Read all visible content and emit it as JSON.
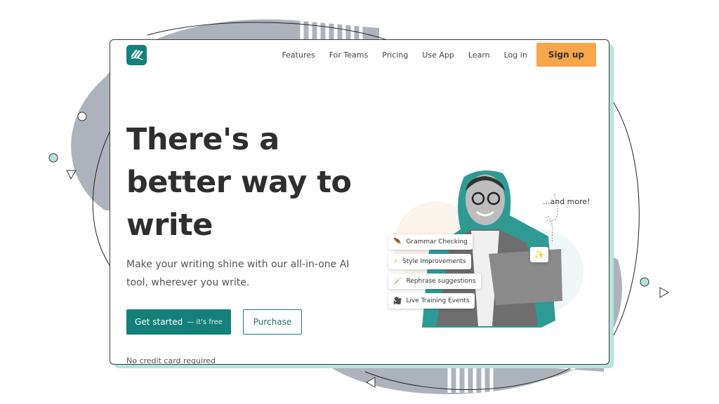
{
  "colors": {
    "brand": "#13807a",
    "accent": "#f7a64c",
    "shadow": "#b5e3dd",
    "blob": "#adb3bd"
  },
  "nav": {
    "logo": "logo-icon",
    "items": [
      "Features",
      "For Teams",
      "Pricing",
      "Use App",
      "Learn",
      "Log in"
    ],
    "signup": "Sign up"
  },
  "hero": {
    "title": "There's a better way to write",
    "subtitle": "Make your writing shine with our all-in-one AI tool, wherever you write.",
    "cta_primary": "Get started",
    "cta_primary_suffix": "— it's free",
    "cta_secondary": "Purchase",
    "note": "No credit card required"
  },
  "features": [
    {
      "label": "Grammar Checking",
      "icon": "feather-icon"
    },
    {
      "label": "Style Improvements",
      "icon": "lightning-icon"
    },
    {
      "label": "Rephrase suggestions",
      "icon": "magic-wand-icon"
    },
    {
      "label": "Live Training Events",
      "icon": "video-camera-icon"
    }
  ],
  "more": "...and more!"
}
